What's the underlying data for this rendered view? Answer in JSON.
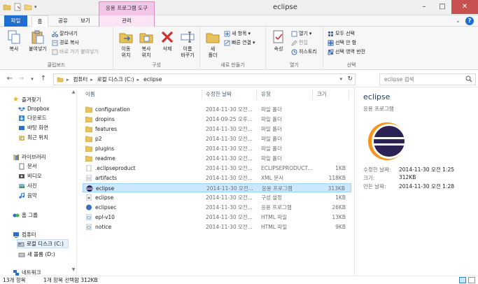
{
  "titlebar": {
    "context_tab_title": "응용 프로그램 도구",
    "window_title": "eclipse",
    "buttons": [
      "–",
      "□",
      "✕"
    ]
  },
  "tabs": {
    "file": "파일",
    "home": "홈",
    "share": "공유",
    "view": "보기",
    "manage": "관리"
  },
  "ribbon": {
    "clipboard": {
      "label": "클립보드",
      "copy": "복사",
      "paste": "붙여넣기",
      "cut": "잘라내기",
      "copy_path": "경로 복사",
      "paste_shortcut": "바로 가기 붙여넣기"
    },
    "organize": {
      "label": "구성",
      "move_to": "이동\n위치",
      "copy_to": "복사\n위치",
      "delete": "삭제",
      "rename": "이름\n바꾸기"
    },
    "new": {
      "label": "새로 만들기",
      "new_folder": "새\n폴더",
      "new_item": "새 항목",
      "easy_access": "빠른 연결"
    },
    "open": {
      "label": "열기",
      "properties": "속성",
      "open": "열기",
      "edit": "편집",
      "history": "히스토리"
    },
    "select": {
      "label": "선택",
      "select_all": "모두 선택",
      "select_none": "선택 안 함",
      "invert": "선택 영역 반전"
    }
  },
  "address": {
    "crumbs": [
      "컴퓨터",
      "로컬 디스크 (C:)",
      "eclipse"
    ],
    "search_placeholder": "eclipse 검색"
  },
  "navpane": {
    "favorites": "즐겨찾기",
    "dropbox": "Dropbox",
    "downloads": "다운로드",
    "desktop": "바탕 화면",
    "recent": "최근 위치",
    "libraries": "라이브러리",
    "documents": "문서",
    "videos": "비디오",
    "pictures": "사진",
    "music": "음악",
    "homegroup": "홈 그룹",
    "computer": "컴퓨터",
    "local_disk": "로컬 디스크 (C:)",
    "new_volume": "새 볼륨 (D:)",
    "network": "네트워크"
  },
  "filelist": {
    "columns": {
      "name": "이름",
      "date": "수정한 날짜",
      "type": "유형",
      "size": "크기"
    },
    "rows": [
      {
        "name": "configuration",
        "date": "2014-11-30 오전...",
        "type": "파일 폴더",
        "size": "",
        "icon": "folder-icon"
      },
      {
        "name": "dropins",
        "date": "2014-09-25 오후...",
        "type": "파일 폴더",
        "size": "",
        "icon": "folder-icon"
      },
      {
        "name": "features",
        "date": "2014-11-30 오전...",
        "type": "파일 폴더",
        "size": "",
        "icon": "folder-icon"
      },
      {
        "name": "p2",
        "date": "2014-11-30 오전...",
        "type": "파일 폴더",
        "size": "",
        "icon": "folder-icon"
      },
      {
        "name": "plugins",
        "date": "2014-11-30 오전...",
        "type": "파일 폴더",
        "size": "",
        "icon": "folder-icon"
      },
      {
        "name": "readme",
        "date": "2014-11-30 오전...",
        "type": "파일 폴더",
        "size": "",
        "icon": "folder-icon"
      },
      {
        "name": ".eclipseproduct",
        "date": "2014-11-30 오전...",
        "type": "ECLIPSEPRODUCT...",
        "size": "1KB",
        "icon": "file-icon"
      },
      {
        "name": "artifacts",
        "date": "2014-11-30 오전...",
        "type": "XML 문서",
        "size": "118KB",
        "icon": "xml-file-icon"
      },
      {
        "name": "eclipse",
        "date": "2014-11-30 오전...",
        "type": "응용 프로그램",
        "size": "313KB",
        "icon": "eclipse-app-icon",
        "selected": true
      },
      {
        "name": "eclipse",
        "date": "2014-11-30 오전...",
        "type": "구성 설정",
        "size": "1KB",
        "icon": "settings-file-icon"
      },
      {
        "name": "eclipsec",
        "date": "2014-11-30 오전...",
        "type": "응용 프로그램",
        "size": "26KB",
        "icon": "app-icon"
      },
      {
        "name": "epl-v10",
        "date": "2014-11-30 오전...",
        "type": "HTML 파일",
        "size": "13KB",
        "icon": "html-file-icon"
      },
      {
        "name": "notice",
        "date": "2014-11-30 오전...",
        "type": "HTML 파일",
        "size": "9KB",
        "icon": "html-file-icon"
      }
    ]
  },
  "details": {
    "title": "eclipse",
    "subtitle": "응용 프로그램",
    "modified_label": "수정한 날짜:",
    "modified_value": "2014-11-30 오전 1:25",
    "size_label": "크기:",
    "size_value": "312KB",
    "created_label": "만든 날짜:",
    "created_value": "2014-11-30 오전 1:28"
  },
  "statusbar": {
    "count": "13개 항목",
    "selection": "1개 항목 선택함 312KB"
  },
  "colors": {
    "file_tab": "#1e6fcf",
    "context_tab": "#f3c6e8",
    "selection": "#cce8ff",
    "folder": "#e8c25a"
  }
}
